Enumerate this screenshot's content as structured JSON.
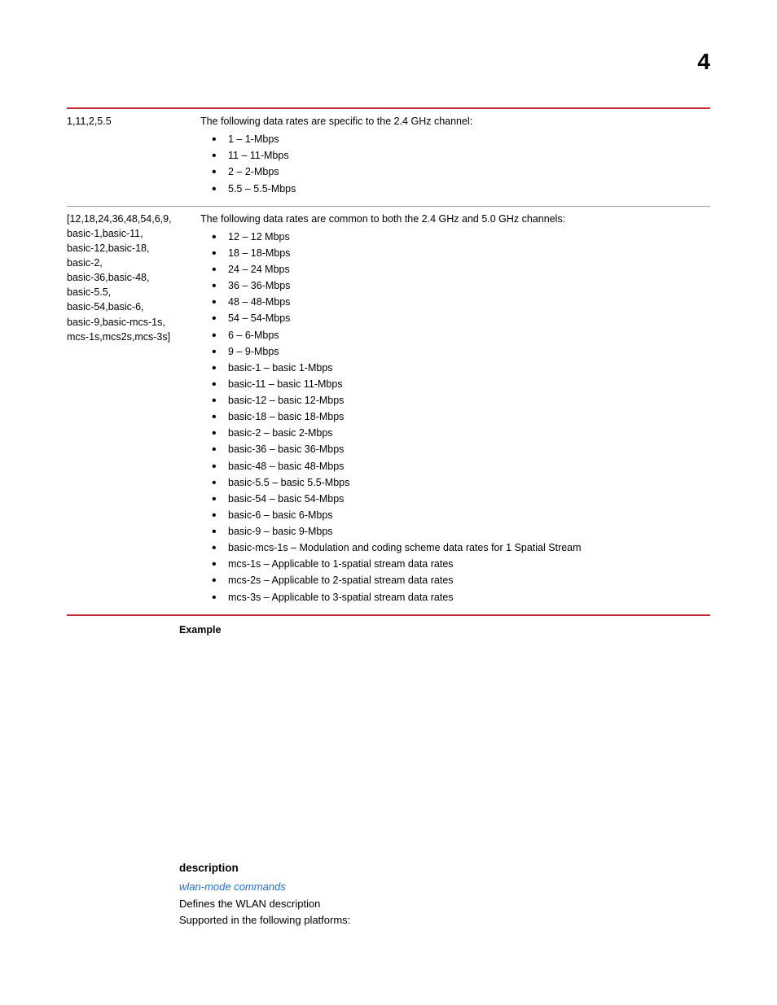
{
  "page_number": "4",
  "table": {
    "rows": [
      {
        "left": "1,11,2,5.5",
        "intro": "The following data rates are specific to the 2.4 GHz channel:",
        "items": [
          "1 – 1-Mbps",
          "11 – 11-Mbps",
          "2 – 2-Mbps",
          "5.5 – 5.5-Mbps"
        ]
      },
      {
        "left": "[12,18,24,36,48,54,6,9,\nbasic-1,basic-11,\nbasic-12,basic-18,\nbasic-2,\nbasic-36,basic-48,\nbasic-5.5,\nbasic-54,basic-6,\nbasic-9,basic-mcs-1s,\nmcs-1s,mcs2s,mcs-3s]",
        "intro": "The following data rates are common to both the 2.4 GHz and 5.0 GHz channels:",
        "items": [
          "12 – 12 Mbps",
          "18 – 18-Mbps",
          "24 – 24 Mbps",
          "36 – 36-Mbps",
          "48 – 48-Mbps",
          "54 – 54-Mbps",
          "6 – 6-Mbps",
          "9 – 9-Mbps",
          "basic-1 – basic 1-Mbps",
          "basic-11 – basic 11-Mbps",
          "basic-12 – basic 12-Mbps",
          "basic-18 – basic 18-Mbps",
          "basic-2 – basic 2-Mbps",
          "basic-36 – basic 36-Mbps",
          "basic-48 – basic 48-Mbps",
          "basic-5.5 – basic 5.5-Mbps",
          "basic-54 – basic 54-Mbps",
          "basic-6 – basic 6-Mbps",
          "basic-9 – basic 9-Mbps",
          "basic-mcs-1s – Modulation and coding scheme data rates for 1 Spatial Stream",
          "mcs-1s – Applicable to 1-spatial stream data rates",
          "mcs-2s – Applicable to 2-spatial stream data rates",
          "mcs-3s – Applicable to 3-spatial stream data rates"
        ]
      }
    ]
  },
  "example_heading": "Example",
  "section": {
    "heading": "description",
    "link": "wlan-mode commands",
    "line1": "Defines the WLAN description",
    "line2": "Supported in the following platforms:"
  }
}
